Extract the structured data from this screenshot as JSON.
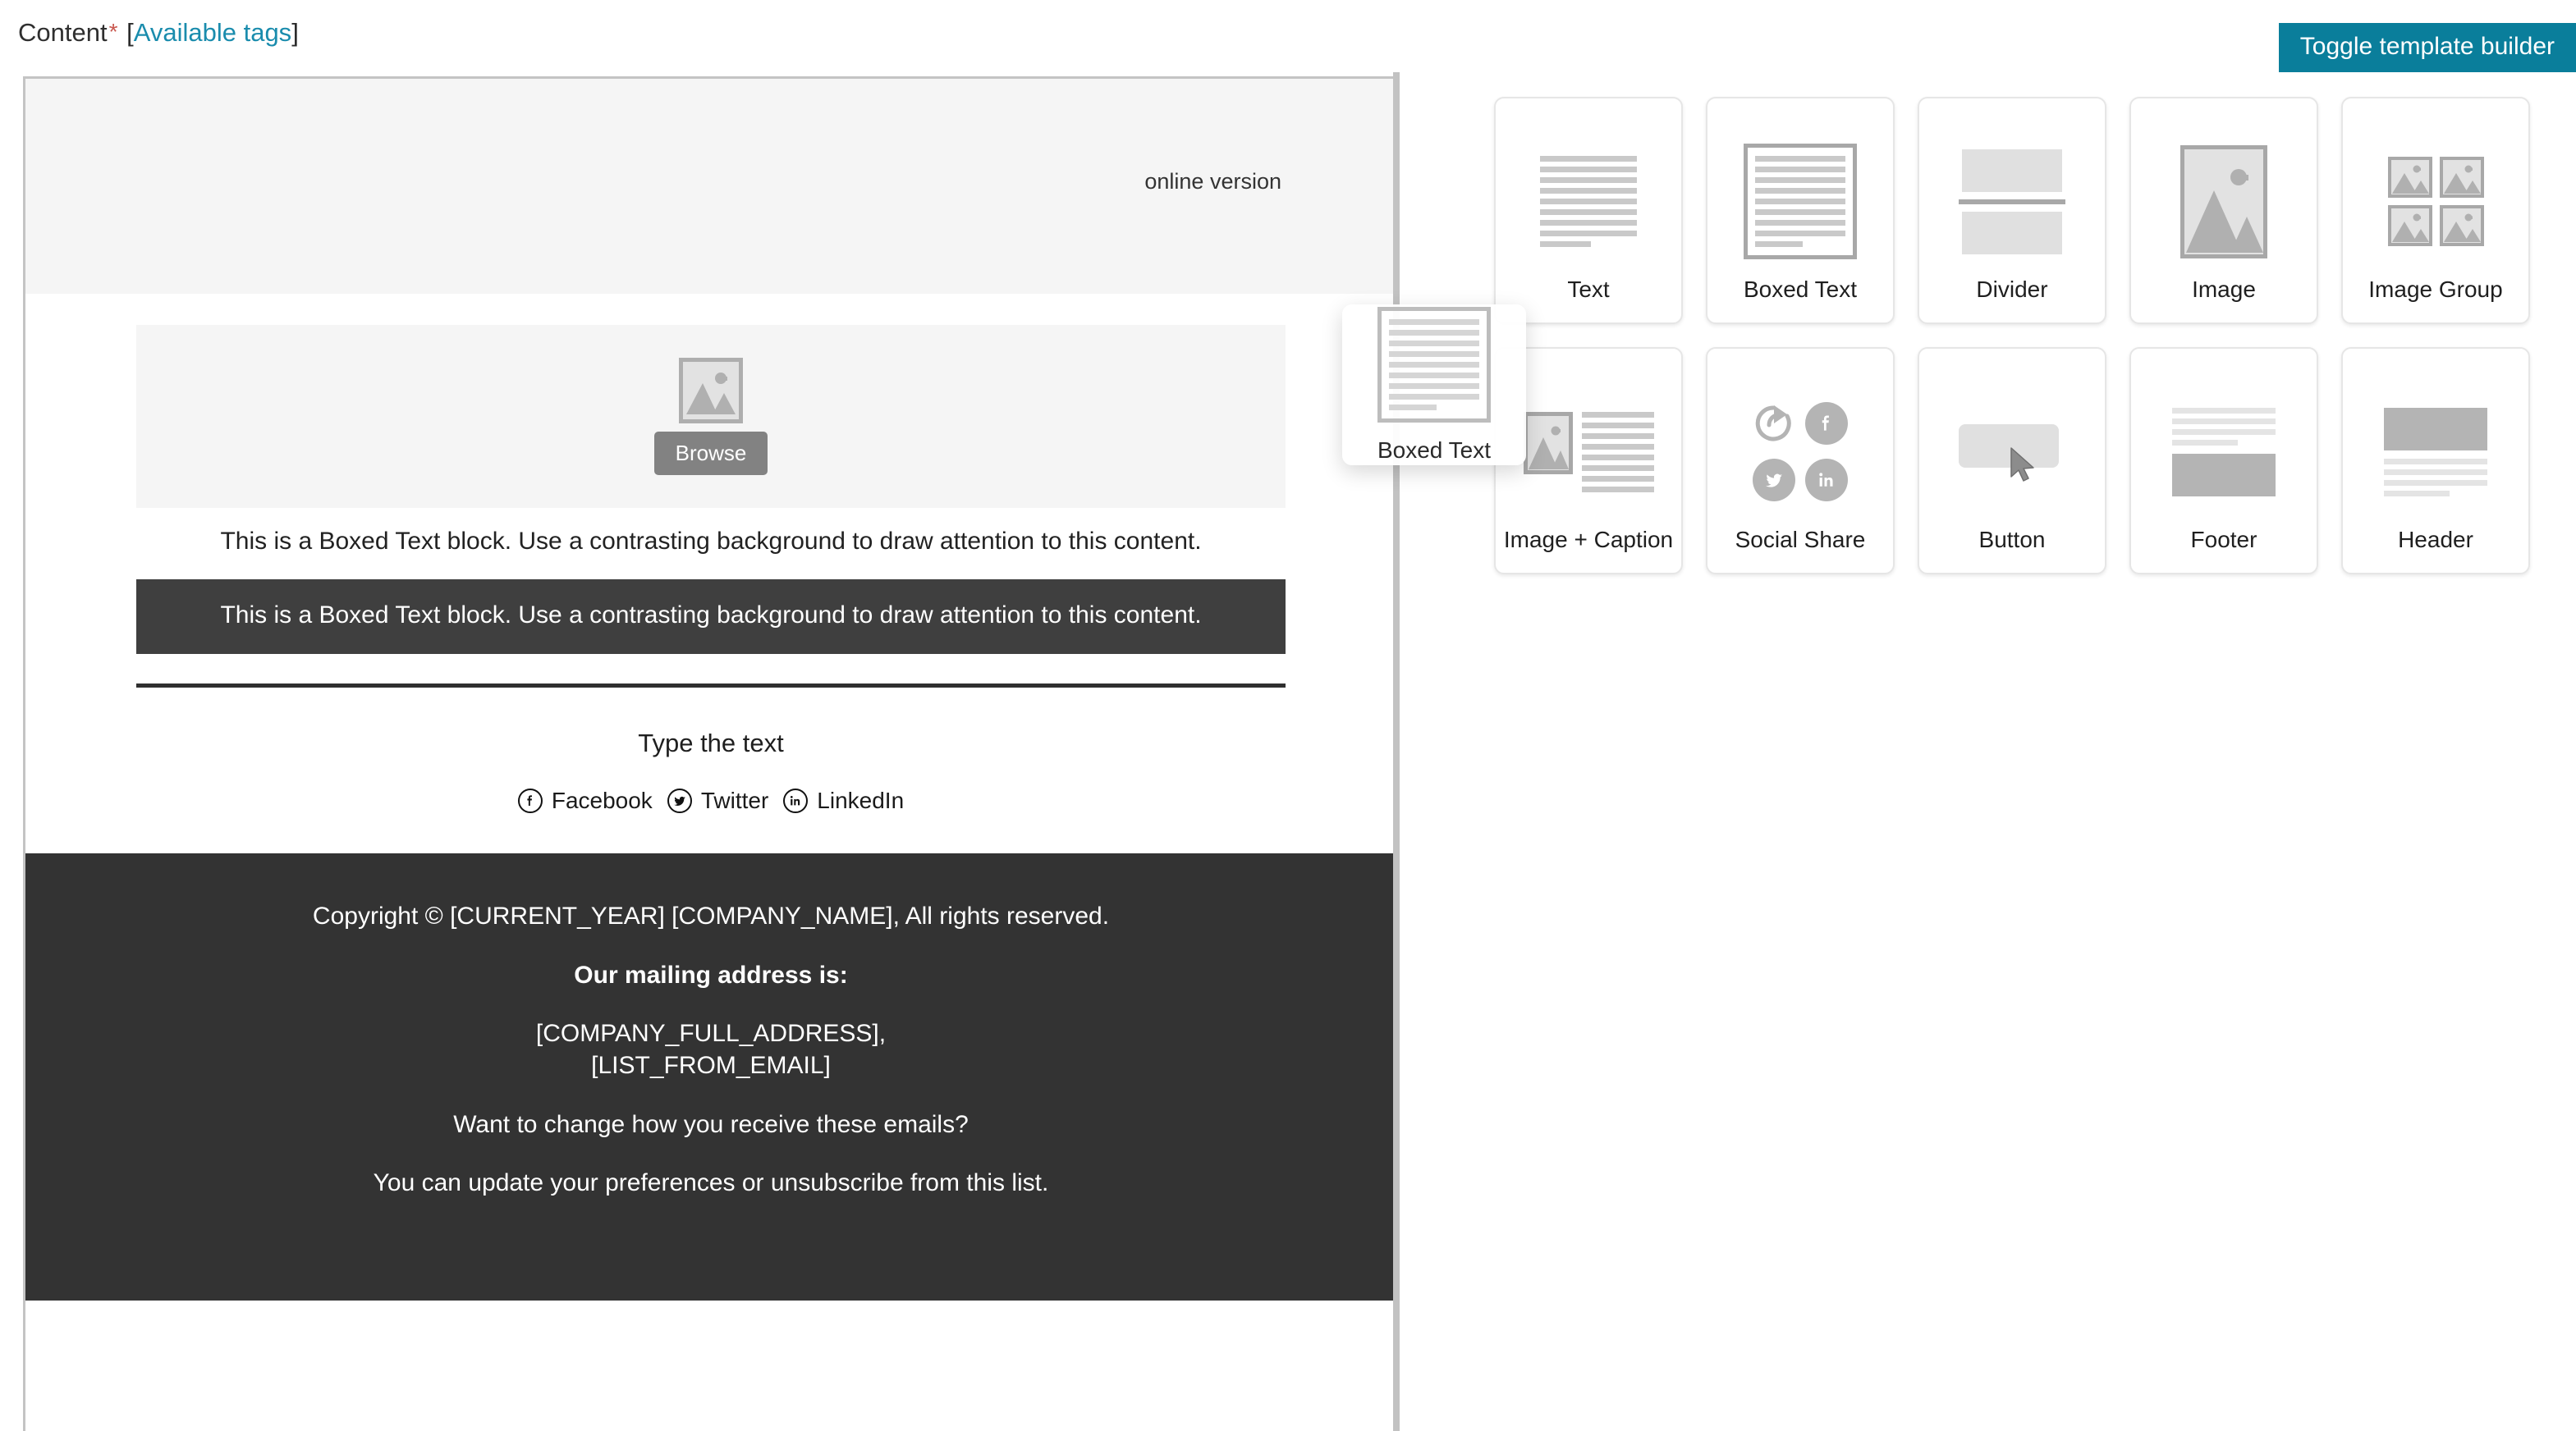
{
  "topbar": {
    "content_label": "Content",
    "required_mark": "*",
    "bracket_open": "[",
    "available_tags": "Available tags",
    "bracket_close": "]",
    "toggle_builder_label": "Toggle template builder",
    "accent_color": "#0a7e9b",
    "link_color": "#1a8cad",
    "required_color": "#c9584f"
  },
  "email": {
    "header_band": {
      "online_version": "online version"
    },
    "image_block": {
      "browse_label": "Browse",
      "placeholder_icon": "image-placeholder-icon"
    },
    "plain_text": "This is a Boxed Text block. Use a contrasting background to draw attention to this content.",
    "boxed_text": "This is a Boxed Text block. Use a contrasting background to draw attention to this content.",
    "boxed_bg": "#3f3f3f",
    "type_text": "Type the text",
    "social": [
      {
        "label": "Facebook",
        "icon": "facebook-icon"
      },
      {
        "label": "Twitter",
        "icon": "twitter-icon"
      },
      {
        "label": "LinkedIn",
        "icon": "linkedin-icon"
      }
    ],
    "footer": {
      "bg": "#333333",
      "copyright": "Copyright © [CURRENT_YEAR] [COMPANY_NAME], All rights reserved.",
      "mailing_heading": "Our mailing address is:",
      "address_line1": "[COMPANY_FULL_ADDRESS],",
      "address_line2": "[LIST_FROM_EMAIL]",
      "change_prefs": "Want to change how you receive these emails?",
      "unsubscribe": "You can update your preferences or unsubscribe from this list."
    }
  },
  "builder": {
    "tiles": [
      {
        "label": "Text",
        "art": "text"
      },
      {
        "label": "Boxed Text",
        "art": "boxed-text"
      },
      {
        "label": "Divider",
        "art": "divider"
      },
      {
        "label": "Image",
        "art": "image"
      },
      {
        "label": "Image Group",
        "art": "image-group"
      },
      {
        "label": "Image + Caption",
        "art": "image-caption"
      },
      {
        "label": "Social Share",
        "art": "social-share"
      },
      {
        "label": "Button",
        "art": "button"
      },
      {
        "label": "Footer",
        "art": "footer"
      },
      {
        "label": "Header",
        "art": "header"
      }
    ],
    "drag_ghost": {
      "label": "Boxed Text"
    }
  }
}
